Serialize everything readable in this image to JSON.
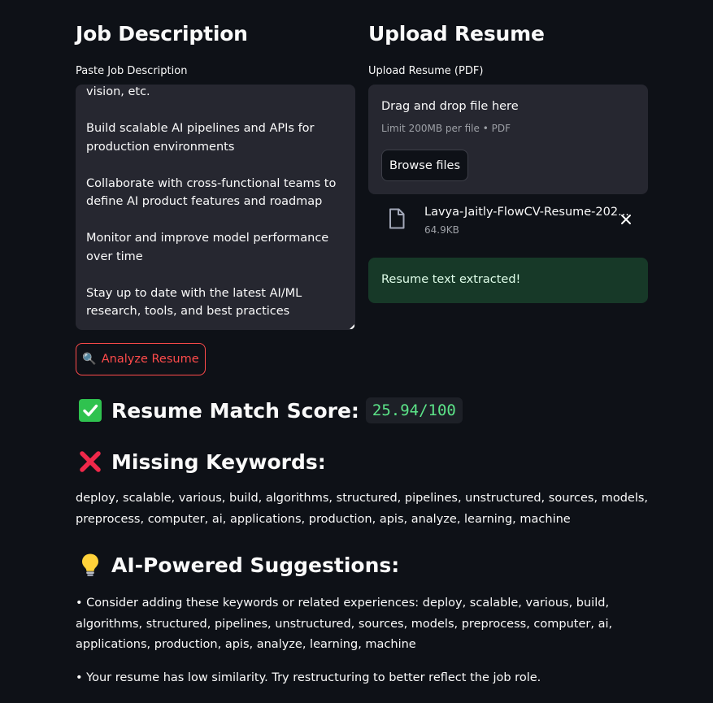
{
  "left_column": {
    "title": "Job Description",
    "field_label": "Paste Job Description",
    "textarea_value": "vision, etc.\n\nBuild scalable AI pipelines and APIs for production environments\n\nCollaborate with cross-functional teams to define AI product features and roadmap\n\nMonitor and improve model performance over time\n\nStay up to date with the latest AI/ML research, tools, and best practices"
  },
  "right_column": {
    "title": "Upload Resume",
    "field_label": "Upload Resume (PDF)",
    "dropzone": {
      "title": "Drag and drop file here",
      "limit": "Limit 200MB per file • PDF",
      "browse_label": "Browse files"
    },
    "file": {
      "name": "Lavya-Jaitly-FlowCV-Resume-202...",
      "size": "64.9KB",
      "icon": "file-icon"
    },
    "success_message": "Resume text extracted!"
  },
  "analyze_button": {
    "icon": "🔍",
    "label": "Analyze Resume"
  },
  "score": {
    "icon": "✅",
    "label": "Resume Match Score:",
    "value": "25.94/100"
  },
  "missing": {
    "icon": "❌",
    "label": "Missing Keywords:",
    "text": "deploy, scalable, various, build, algorithms, structured, pipelines, unstructured, sources, models, preprocess, computer, ai, applications, production, apis, analyze, learning, machine"
  },
  "suggestions": {
    "icon": "💡",
    "label": "AI-Powered Suggestions:",
    "items": [
      "• Consider adding these keywords or related experiences: deploy, scalable, various, build, algorithms, structured, pipelines, unstructured, sources, models, preprocess, computer, ai, applications, production, apis, analyze, learning, machine",
      "• Your resume has low similarity. Try restructuring to better reflect the job role."
    ]
  },
  "colors": {
    "background": "#0e1117",
    "surface": "#262730",
    "accent": "#ff4b4b",
    "success_bg": "#173928",
    "score_green": "#5ce488"
  }
}
